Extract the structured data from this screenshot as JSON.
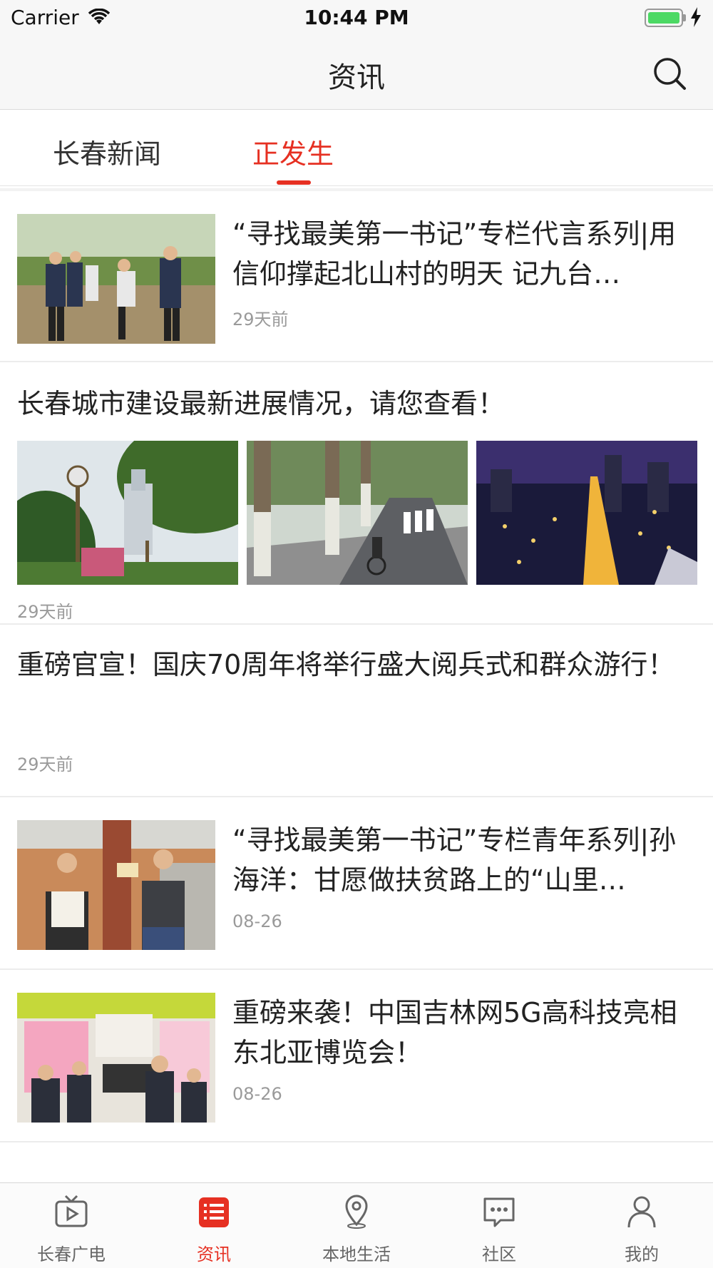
{
  "status_bar": {
    "carrier": "Carrier",
    "time": "10:44 PM"
  },
  "nav": {
    "title": "资讯",
    "search_icon": "search-icon"
  },
  "tabs": [
    {
      "label": "长春新闻",
      "active": false
    },
    {
      "label": "正发生",
      "active": true
    }
  ],
  "feed": [
    {
      "title": "“寻找最美第一书记”专栏代言系列|用信仰撑起北山村的明天 记九台…",
      "time": "29天前",
      "layout": "thumb-right"
    },
    {
      "title": "长春城市建设最新进展情况，请您查看！",
      "time": "29天前",
      "layout": "three-images"
    },
    {
      "title": "重磅官宣！国庆70周年将举行盛大阅兵式和群众游行！",
      "time": "29天前",
      "layout": "text-only"
    },
    {
      "title": "“寻找最美第一书记”专栏青年系列|孙海洋：甘愿做扶贫路上的“山里…",
      "time": "08-26",
      "layout": "thumb-right"
    },
    {
      "title": "重磅来袭！中国吉林网5G高科技亮相东北亚博览会！",
      "time": "08-26",
      "layout": "thumb-right"
    }
  ],
  "tabbar": [
    {
      "label": "长春广电",
      "icon": "tv-icon",
      "active": false
    },
    {
      "label": "资讯",
      "icon": "list-icon",
      "active": true
    },
    {
      "label": "本地生活",
      "icon": "location-icon",
      "active": false
    },
    {
      "label": "社区",
      "icon": "chat-icon",
      "active": false
    },
    {
      "label": "我的",
      "icon": "person-icon",
      "active": false
    }
  ],
  "colors": {
    "accent": "#e63022",
    "text": "#222222",
    "muted": "#9a9a9a"
  }
}
